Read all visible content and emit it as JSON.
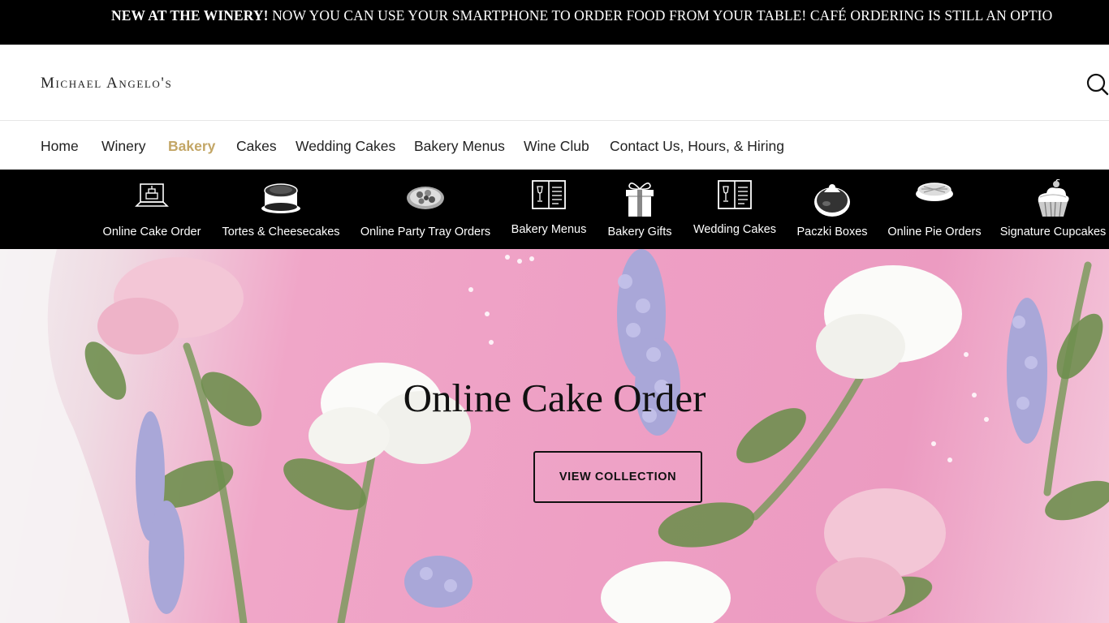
{
  "announcement": {
    "bold": "NEW AT THE WINERY!",
    "text": " NOW YOU CAN USE YOUR SMARTPHONE TO ORDER FOOD FROM YOUR TABLE! CAFÉ ORDERING IS STILL AN OPTIO"
  },
  "header": {
    "logo": "Michael Angelo's",
    "search_icon": "search-icon"
  },
  "nav": {
    "items": [
      {
        "label": "Home"
      },
      {
        "label": "Winery"
      },
      {
        "label": "Bakery",
        "active": true
      },
      {
        "label": "Cakes"
      },
      {
        "label": "Wedding Cakes"
      },
      {
        "label": "Bakery Menus"
      },
      {
        "label": "Wine Club"
      },
      {
        "label": "Contact Us, Hours, & Hiring"
      }
    ],
    "active_color": "#c3a666"
  },
  "categories": [
    {
      "label": "Online Cake Order",
      "icon": "laptop-cake-icon"
    },
    {
      "label": "Tortes & Cheesecakes",
      "icon": "cheesecake-icon"
    },
    {
      "label": "Online Party Tray Orders",
      "icon": "party-tray-icon"
    },
    {
      "label": "Bakery Menus",
      "icon": "menu-book-icon"
    },
    {
      "label": "Bakery Gifts",
      "icon": "gift-box-icon"
    },
    {
      "label": "Wedding Cakes",
      "icon": "menu-book-icon"
    },
    {
      "label": "Paczki Boxes",
      "icon": "paczki-icon"
    },
    {
      "label": "Online Pie Orders",
      "icon": "pie-icon"
    },
    {
      "label": "Signature Cupcakes",
      "icon": "cupcake-icon"
    }
  ],
  "hero": {
    "title": "Online Cake Order",
    "button": "VIEW COLLECTION"
  }
}
